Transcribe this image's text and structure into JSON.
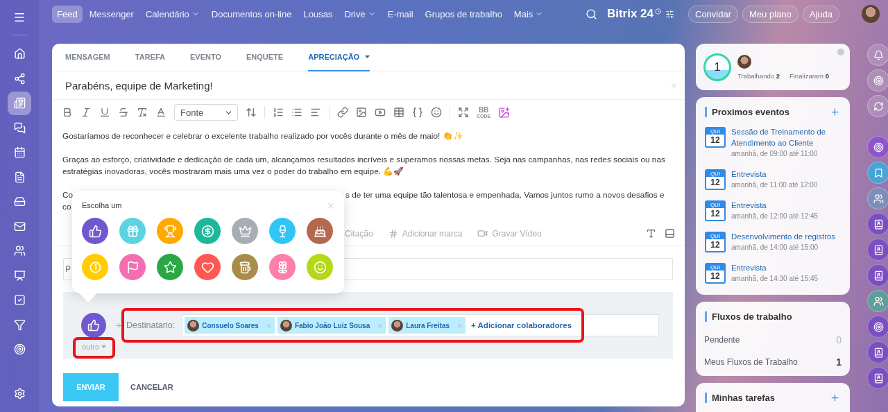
{
  "sidebar": {
    "items": [
      {
        "selected": false
      },
      {
        "selected": false
      },
      {
        "selected": true
      },
      {
        "selected": false
      },
      {
        "selected": false
      },
      {
        "selected": false
      },
      {
        "selected": false
      },
      {
        "selected": false
      },
      {
        "selected": false
      },
      {
        "selected": false
      },
      {
        "selected": false
      },
      {
        "selected": false
      },
      {
        "selected": false
      }
    ]
  },
  "top_nav": {
    "items": [
      {
        "label": "Feed",
        "selected": true,
        "dropdown": false
      },
      {
        "label": "Messenger",
        "selected": false,
        "dropdown": false
      },
      {
        "label": "Calendário",
        "selected": false,
        "dropdown": true
      },
      {
        "label": "Documentos on-line",
        "selected": false,
        "dropdown": false
      },
      {
        "label": "Lousas",
        "selected": false,
        "dropdown": false
      },
      {
        "label": "Drive",
        "selected": false,
        "dropdown": true
      },
      {
        "label": "E-mail",
        "selected": false,
        "dropdown": false
      },
      {
        "label": "Grupos de trabalho",
        "selected": false,
        "dropdown": false
      },
      {
        "label": "Mais",
        "selected": false,
        "dropdown": true
      }
    ],
    "logo": "Bitrix 24",
    "buttons": [
      "Convidar",
      "Meu plano",
      "Ajuda"
    ]
  },
  "composer": {
    "tabs": [
      {
        "label": "MENSAGEM",
        "selected": false,
        "dropdown": false
      },
      {
        "label": "TAREFA",
        "selected": false,
        "dropdown": false
      },
      {
        "label": "EVENTO",
        "selected": false,
        "dropdown": false
      },
      {
        "label": "ENQUETE",
        "selected": false,
        "dropdown": false
      },
      {
        "label": "APRECIAÇÃO",
        "selected": true,
        "dropdown": true
      }
    ],
    "title": "Parabéns, equipe de Marketing!",
    "font_select": "Fonte",
    "bbcode_top": "BB",
    "bbcode_bottom": "CODE",
    "paragraphs": [
      {
        "lines": [
          [
            "Gostaríamos de reconhecer e celebrar o excelente trabalho realizado por vocês durante o mês de maio! 👏✨"
          ]
        ]
      },
      {
        "lines": [
          [
            "Graças ao esforço, criatividade e dedicação de cada um, alcançamos resultados incríveis e superamos nossas metas. Seja nas campanhas, nas redes sociais ou nas"
          ],
          [
            "estratégias inovadoras, vocês mostraram mais uma vez o poder do trabalho em equipe. 💪🚀"
          ]
        ]
      },
      {
        "lines": [
          [
            "Co",
            "s de ter uma equipe tão talentosa e empenhada. Vamos juntos rumo a novos desafios e"
          ],
          [
            "co"
          ]
        ]
      }
    ],
    "extra_tools": [
      {
        "kind": "quote",
        "label": "Citação"
      },
      {
        "kind": "tag",
        "label": "Adicionar marca"
      },
      {
        "kind": "video",
        "label": "Gravar Vídeo"
      }
    ],
    "field_text": "P",
    "chosen_badge": {
      "kind": "like",
      "color": "#7158d1"
    },
    "badge_type": "outro",
    "recipient_label": "Destinatario:",
    "recipients": [
      "Consuelo Soares",
      "Fabio João Luiz Sousa",
      "Laura Freitas"
    ],
    "add_recipients": "+ Adicionar colaboradores",
    "submit": "ENVIAR",
    "cancel": "CANCELAR"
  },
  "badge_picker": {
    "title": "Escolha um",
    "badges": [
      {
        "kind": "like",
        "color": "#7158d1"
      },
      {
        "kind": "gift",
        "color": "#5bd3e0"
      },
      {
        "kind": "cup",
        "color": "#ffa900"
      },
      {
        "kind": "money",
        "color": "#1bb89b"
      },
      {
        "kind": "crown",
        "color": "#a8adb4"
      },
      {
        "kind": "drink",
        "color": "#2fc6f6"
      },
      {
        "kind": "cake",
        "color": "#b2694f"
      },
      {
        "kind": "medal",
        "color": "#ffcd00"
      },
      {
        "kind": "flag",
        "color": "#f36fb1"
      },
      {
        "kind": "star",
        "color": "#29a845"
      },
      {
        "kind": "heart",
        "color": "#ff5752"
      },
      {
        "kind": "beer",
        "color": "#a98c4a"
      },
      {
        "kind": "flower",
        "color": "#ff7fa9"
      },
      {
        "kind": "smile",
        "color": "#b4d916"
      }
    ]
  },
  "timeman": {
    "counter": "1",
    "working_label": "Trabalhando",
    "working": "2",
    "finished_label": "Finalizaram",
    "finished": "0"
  },
  "events": {
    "title": "Proximos eventos",
    "items": [
      {
        "day": "QUI",
        "date": "12",
        "title": "Sessão de Treinamento de Atendimento ao Cliente",
        "time": "amanhã, de 09:00 até 11:00"
      },
      {
        "day": "QUI",
        "date": "12",
        "title": "Entrevista",
        "time": "amanhã, de 11:00 até 12:00"
      },
      {
        "day": "QUI",
        "date": "12",
        "title": "Entrevista",
        "time": "amanhã, de 12:00 até 12:45"
      },
      {
        "day": "QUI",
        "date": "12",
        "title": "Desenvolvimento de registros",
        "time": "amanhã, de 14:00 até 15:00"
      },
      {
        "day": "QUI",
        "date": "12",
        "title": "Entrevista",
        "time": "amanhã, de 14:30 até 15:45"
      }
    ]
  },
  "workflows": {
    "title": "Fluxos de trabalho",
    "rows": [
      {
        "label": "Pendente",
        "count": "0",
        "muted": true
      },
      {
        "label": "Meus Fluxos de Trabalho",
        "count": "1",
        "muted": false
      }
    ]
  },
  "tasks": {
    "title": "Minhas tarefas"
  }
}
